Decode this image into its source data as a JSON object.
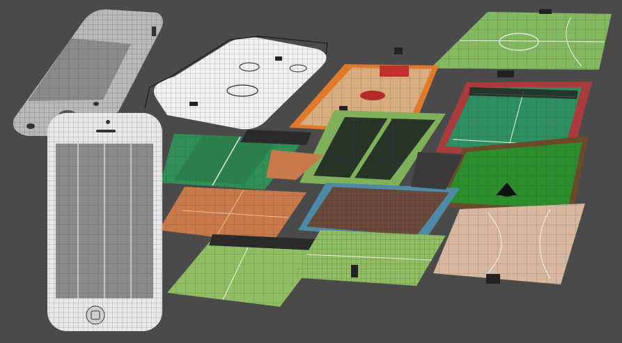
{
  "scene": {
    "background": "#4a4a4a",
    "objects": [
      {
        "name": "phone-tilted",
        "icon": "smartphone-icon",
        "color": "#b9b9b9"
      },
      {
        "name": "phone-front",
        "icon": "smartphone-icon",
        "color": "#e8e8e8"
      },
      {
        "name": "hockey-rink",
        "icon": "ice-hockey-rink-icon",
        "color": "#f2f2f2"
      },
      {
        "name": "basketball-court",
        "icon": "basketball-court-icon",
        "color": "#d9a878"
      },
      {
        "name": "futsal-court",
        "icon": "futsal-court-icon",
        "color": "#7fb05a"
      },
      {
        "name": "table-tennis-court",
        "icon": "table-tennis-icon",
        "color": "#2f8f55"
      },
      {
        "name": "tennis-court-red",
        "icon": "tennis-court-icon",
        "color": "#a63a3a"
      },
      {
        "name": "volleyball-court",
        "icon": "volleyball-court-icon",
        "color": "#2a3a2a"
      },
      {
        "name": "billiard-table",
        "icon": "billiard-table-icon",
        "color": "#2d8a2d"
      },
      {
        "name": "clay-court",
        "icon": "clay-court-icon",
        "color": "#c8784a"
      },
      {
        "name": "boxing-ring",
        "icon": "boxing-ring-icon",
        "color": "#6a4a3a"
      },
      {
        "name": "handball-court",
        "icon": "handball-court-icon",
        "color": "#d6b8a0"
      },
      {
        "name": "grass-court",
        "icon": "grass-court-icon",
        "color": "#8fbe62"
      },
      {
        "name": "tennis-grass-court",
        "icon": "tennis-court-icon",
        "color": "#8fbe62"
      }
    ]
  }
}
